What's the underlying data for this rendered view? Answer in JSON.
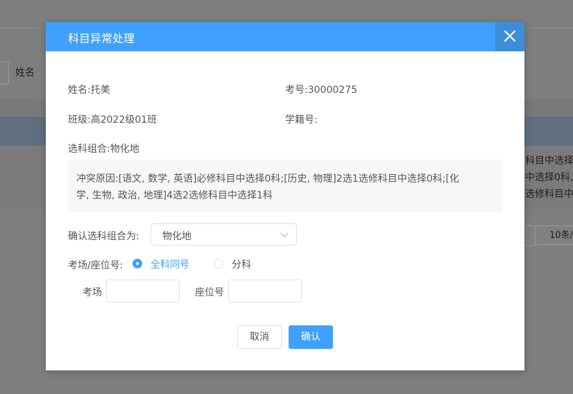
{
  "background": {
    "name_label": "姓名",
    "right_lines": [
      "科目中选择0",
      "中选择0科,",
      "选修科目中选"
    ],
    "page_size": "10条/"
  },
  "modal": {
    "title": "科目异常处理",
    "name_label": "姓名:",
    "name_value": "托美",
    "exam_no_label": "考号:",
    "exam_no_value": "30000275",
    "class_label": "班级:",
    "class_value": "高2022级01班",
    "student_id_label": "学籍号:",
    "student_id_value": "",
    "combo_label": "选科组合:",
    "combo_value": "物化地",
    "reason_line1": "冲突原因:[语文, 数学, 英语]必修科目中选择0科;[历史, 物理]2选1选修科目中选择0科;[化",
    "reason_line2": "学, 生物, 政治, 地理]4选2选修科目中选择1科",
    "confirm_label": "确认选科组合为:",
    "confirm_select_value": "物化地",
    "seat_label": "考场/座位号:",
    "radio_same": "全科同号",
    "radio_split": "分科",
    "room_label": "考场",
    "room_value": "",
    "seat_no_label": "座位号",
    "seat_no_value": "",
    "cancel_label": "取消",
    "ok_label": "确认"
  },
  "colors": {
    "primary": "#40a0ff",
    "close_bg": "#3c8ed9",
    "overlay": "#7f7f7f"
  },
  "icons": {
    "close": "close-icon",
    "dropdown": "chevron-down-icon"
  }
}
